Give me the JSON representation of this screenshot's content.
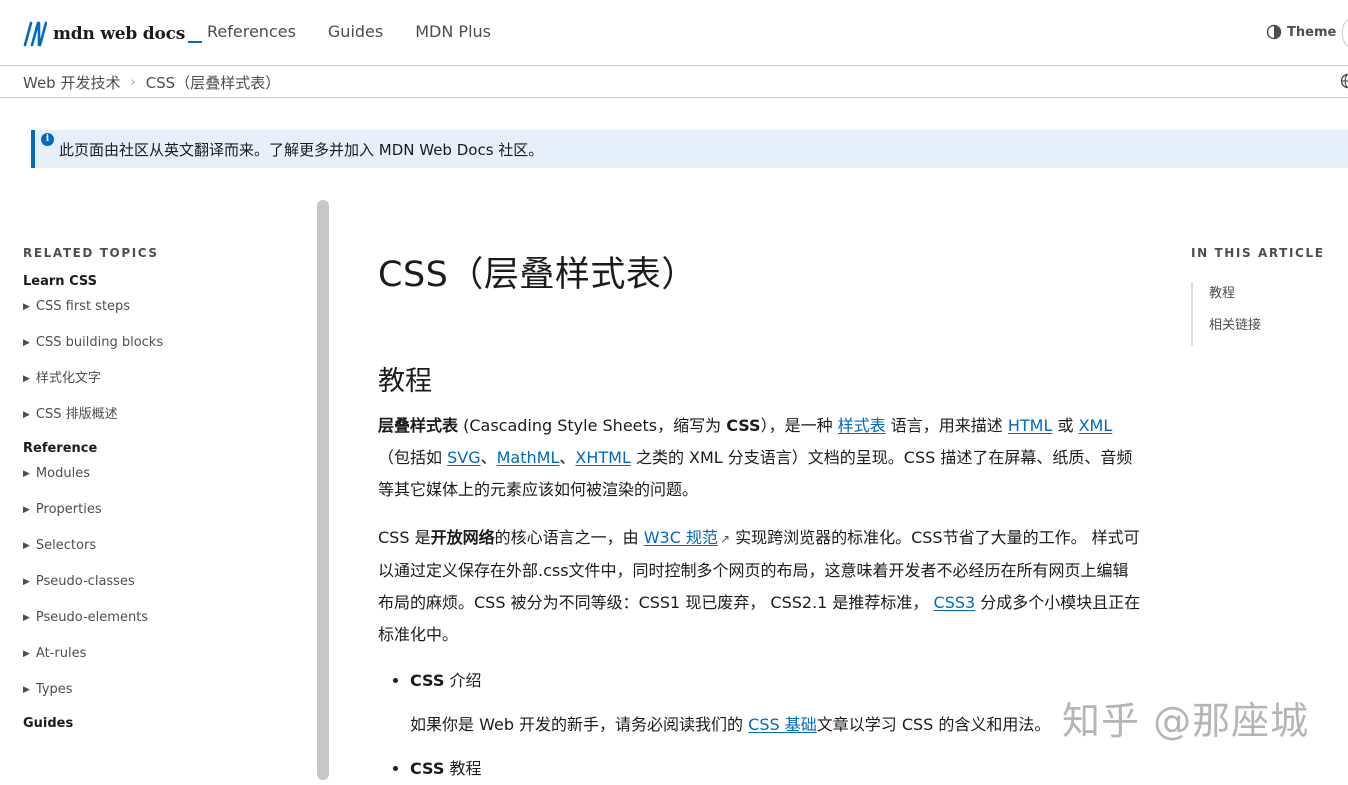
{
  "header": {
    "logo_text": "mdn web docs",
    "nav": [
      "References",
      "Guides",
      "MDN Plus"
    ],
    "theme_label": "Theme"
  },
  "breadcrumb": {
    "items": [
      "Web 开发技术",
      "CSS（层叠样式表）"
    ],
    "separator": "›"
  },
  "notice": {
    "text": "此页面由社区从英文翻译而来。了解更多并加入 MDN Web Docs 社区。"
  },
  "sidebar": {
    "title": "RELATED TOPICS",
    "groups": [
      {
        "label": "Learn CSS",
        "items": [
          "CSS first steps",
          "CSS building blocks",
          "样式化文字",
          "CSS 排版概述"
        ]
      },
      {
        "label": "Reference",
        "items": [
          "Modules",
          "Properties",
          "Selectors",
          "Pseudo-classes",
          "Pseudo-elements",
          "At-rules",
          "Types"
        ]
      },
      {
        "label": "Guides",
        "items": []
      }
    ]
  },
  "main": {
    "title": "CSS（层叠样式表）",
    "section_heading": "教程",
    "p1": {
      "bold1": "层叠样式表",
      "t1": " (Cascading Style Sheets，缩写为 ",
      "bold2": "CSS",
      "t2": "），是一种 ",
      "link_stylesheet": "样式表",
      "t3": " 语言，用来描述 ",
      "link_html": "HTML",
      "t4": " 或 ",
      "link_xml": "XML",
      "t5": "（包括如 ",
      "link_svg": "SVG",
      "t6": "、",
      "link_mathml": "MathML",
      "t7": "、",
      "link_xhtml": "XHTML",
      "t8": " 之类的 XML 分支语言）文档的呈现。CSS 描述了在屏幕、纸质、音频等其它媒体上的元素应该如何被渲染的问题。"
    },
    "p2": {
      "t1": "CSS 是",
      "bold1": "开放网络",
      "t2": "的核心语言之一，由 ",
      "link_w3c": "W3C 规范",
      "t3": " 实现跨浏览器的标准化。CSS节省了大量的工作。 样式可以通过定义保存在外部.css文件中，同时控制多个网页的布局，这意味着开发者不必经历在所有网页上编辑布局的麻烦。CSS 被分为不同等级：CSS1 现已废弃， CSS2.1 是推荐标准， ",
      "link_css3": "CSS3",
      "t4": " 分成多个小模块且正在标准化中。"
    },
    "list": [
      {
        "bold": "CSS",
        "label_rest": " 介绍",
        "desc_t1": "如果你是 Web 开发的新手，请务必阅读我们的 ",
        "desc_link": "CSS 基础",
        "desc_t2": "文章以学习 CSS 的含义和用法。"
      },
      {
        "bold": "CSS",
        "label_rest": " 教程"
      }
    ]
  },
  "toc": {
    "title": "IN THIS ARTICLE",
    "items": [
      "教程",
      "相关链接"
    ]
  },
  "watermark": "知乎 @那座城",
  "colors": {
    "link": "#0069c2",
    "notice_bg": "#e6f0fb",
    "border": "#cdcdcd"
  }
}
